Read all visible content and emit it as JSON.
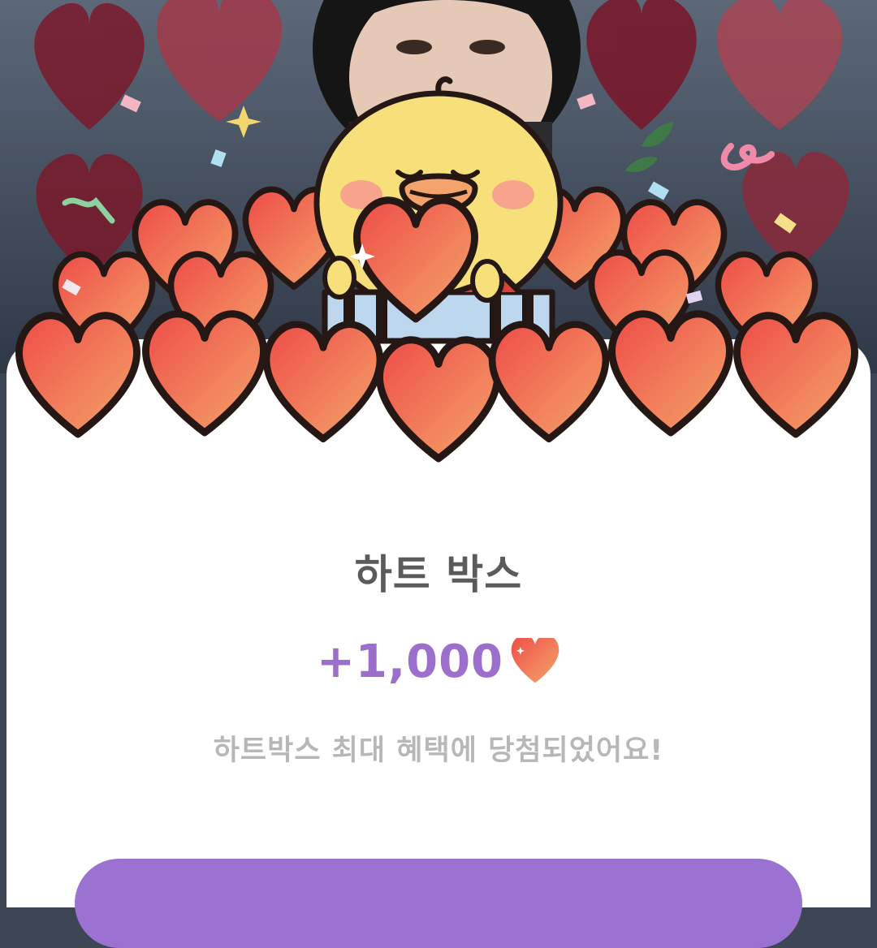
{
  "reward": {
    "title": "하트 박스",
    "amount": "+1,000",
    "amount_icon": "heart-icon",
    "description": "하트박스 최대 혜택에 당첨되었어요!"
  },
  "colors": {
    "accent": "#9c6fcc",
    "button": "#9b72d1",
    "title": "#5b5b5b",
    "description": "#b7b7b7",
    "heart_top": "#f0524a",
    "heart_bottom": "#f3a268",
    "chick": "#f7e07a"
  }
}
